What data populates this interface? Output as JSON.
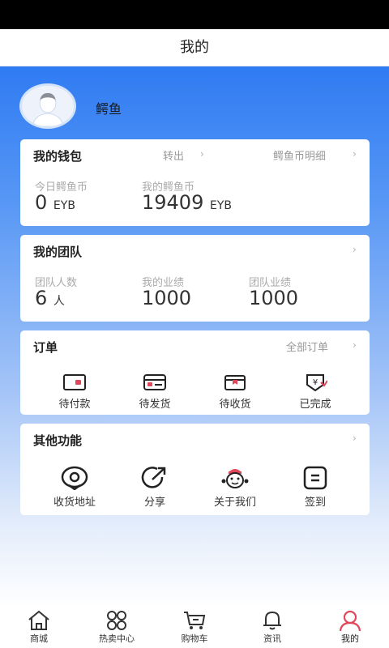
{
  "header": {
    "title": "我的"
  },
  "profile": {
    "username": "鳄鱼"
  },
  "wallet": {
    "title": "我的钱包",
    "transfer_label": "转出",
    "details_label": "鳄鱼币明细",
    "today_label": "今日鳄鱼币",
    "today_value": "0",
    "today_unit": "EYB",
    "total_label": "我的鳄鱼币",
    "total_value": "19409",
    "total_unit": "EYB"
  },
  "team": {
    "title": "我的团队",
    "members_label": "团队人数",
    "members_value": "6",
    "members_unit": "人",
    "my_perf_label": "我的业绩",
    "my_perf_value": "1000",
    "team_perf_label": "团队业绩",
    "team_perf_value": "1000"
  },
  "orders": {
    "title": "订单",
    "all_label": "全部订单",
    "items": [
      {
        "label": "待付款",
        "icon": "wallet-icon"
      },
      {
        "label": "待发货",
        "icon": "card-icon"
      },
      {
        "label": "待收货",
        "icon": "box-icon"
      },
      {
        "label": "已完成",
        "icon": "yuan-done-icon"
      }
    ]
  },
  "other": {
    "title": "其他功能",
    "items": [
      {
        "label": "收货地址",
        "icon": "location-icon"
      },
      {
        "label": "分享",
        "icon": "share-icon"
      },
      {
        "label": "关于我们",
        "icon": "mascot-icon"
      },
      {
        "label": "签到",
        "icon": "checkin-icon"
      }
    ]
  },
  "tabbar": {
    "items": [
      {
        "label": "商城",
        "icon": "home-icon"
      },
      {
        "label": "热卖中心",
        "icon": "grid-icon"
      },
      {
        "label": "购物车",
        "icon": "cart-icon"
      },
      {
        "label": "资讯",
        "icon": "bell-icon"
      },
      {
        "label": "我的",
        "icon": "person-icon",
        "active": true
      }
    ]
  },
  "colors": {
    "accent": "#2f7bf2",
    "active_tab": "#e0475b"
  }
}
